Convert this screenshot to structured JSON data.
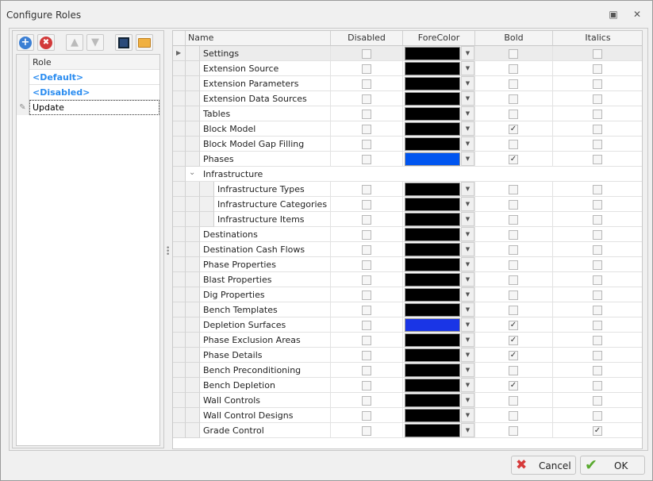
{
  "window": {
    "title": "Configure Roles"
  },
  "roles": {
    "header": "Role",
    "items": [
      {
        "label": "<Default>",
        "style": "default"
      },
      {
        "label": "<Disabled>",
        "style": "default"
      },
      {
        "label": "Update",
        "style": "editing"
      }
    ]
  },
  "grid": {
    "columns": [
      "Name",
      "Disabled",
      "ForeColor",
      "Bold",
      "Italics"
    ],
    "rows": [
      {
        "name": "Settings",
        "level": 0,
        "color": "#000000",
        "disabled": false,
        "bold": false,
        "italics": false,
        "current": true
      },
      {
        "name": "Extension Source",
        "level": 0,
        "color": "#000000",
        "disabled": false,
        "bold": false,
        "italics": false
      },
      {
        "name": "Extension Parameters",
        "level": 0,
        "color": "#000000",
        "disabled": false,
        "bold": false,
        "italics": false
      },
      {
        "name": "Extension Data Sources",
        "level": 0,
        "color": "#000000",
        "disabled": false,
        "bold": false,
        "italics": false
      },
      {
        "name": "Tables",
        "level": 0,
        "color": "#000000",
        "disabled": false,
        "bold": false,
        "italics": false
      },
      {
        "name": "Block Model",
        "level": 0,
        "color": "#000000",
        "disabled": false,
        "bold": true,
        "italics": false
      },
      {
        "name": "Block Model Gap Filling",
        "level": 0,
        "color": "#000000",
        "disabled": false,
        "bold": false,
        "italics": false
      },
      {
        "name": "Phases",
        "level": 0,
        "color": "#0055F0",
        "disabled": false,
        "bold": true,
        "italics": false
      },
      {
        "name": "Infrastructure",
        "level": 0,
        "group": true
      },
      {
        "name": "Infrastructure Types",
        "level": 1,
        "color": "#000000",
        "disabled": false,
        "bold": false,
        "italics": false
      },
      {
        "name": "Infrastructure Categories",
        "level": 1,
        "color": "#000000",
        "disabled": false,
        "bold": false,
        "italics": false
      },
      {
        "name": "Infrastructure Items",
        "level": 1,
        "color": "#000000",
        "disabled": false,
        "bold": false,
        "italics": false
      },
      {
        "name": "Destinations",
        "level": 0,
        "color": "#000000",
        "disabled": false,
        "bold": false,
        "italics": false
      },
      {
        "name": "Destination Cash Flows",
        "level": 0,
        "color": "#000000",
        "disabled": false,
        "bold": false,
        "italics": false
      },
      {
        "name": "Phase Properties",
        "level": 0,
        "color": "#000000",
        "disabled": false,
        "bold": false,
        "italics": false
      },
      {
        "name": "Blast Properties",
        "level": 0,
        "color": "#000000",
        "disabled": false,
        "bold": false,
        "italics": false
      },
      {
        "name": "Dig Properties",
        "level": 0,
        "color": "#000000",
        "disabled": false,
        "bold": false,
        "italics": false
      },
      {
        "name": "Bench Templates",
        "level": 0,
        "color": "#000000",
        "disabled": false,
        "bold": false,
        "italics": false
      },
      {
        "name": "Depletion Surfaces",
        "level": 0,
        "color": "#1A35E6",
        "disabled": false,
        "bold": true,
        "italics": false
      },
      {
        "name": "Phase Exclusion Areas",
        "level": 0,
        "color": "#000000",
        "disabled": false,
        "bold": true,
        "italics": false
      },
      {
        "name": "Phase Details",
        "level": 0,
        "color": "#000000",
        "disabled": false,
        "bold": true,
        "italics": false
      },
      {
        "name": "Bench Preconditioning",
        "level": 0,
        "color": "#000000",
        "disabled": false,
        "bold": false,
        "italics": false
      },
      {
        "name": "Bench Depletion",
        "level": 0,
        "color": "#000000",
        "disabled": false,
        "bold": true,
        "italics": false
      },
      {
        "name": "Wall Controls",
        "level": 0,
        "color": "#000000",
        "disabled": false,
        "bold": false,
        "italics": false
      },
      {
        "name": "Wall Control Designs",
        "level": 0,
        "color": "#000000",
        "disabled": false,
        "bold": false,
        "italics": false
      },
      {
        "name": "Grade Control",
        "level": 0,
        "color": "#000000",
        "disabled": false,
        "bold": false,
        "italics": true
      }
    ]
  },
  "footer": {
    "cancel": "Cancel",
    "ok": "OK"
  },
  "colors": {
    "roleText": "#2a8cf0"
  }
}
